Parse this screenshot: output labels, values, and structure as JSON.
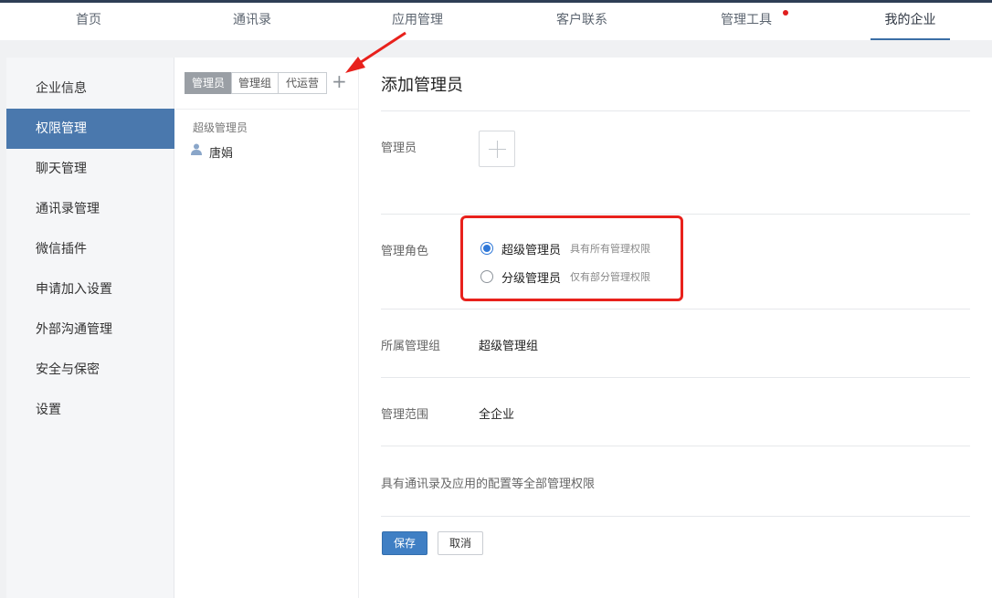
{
  "topnav": {
    "items": [
      "首页",
      "通讯录",
      "应用管理",
      "客户联系",
      "管理工具",
      "我的企业"
    ],
    "active": "我的企业"
  },
  "sidebar": {
    "items": [
      "企业信息",
      "权限管理",
      "聊天管理",
      "通讯录管理",
      "微信插件",
      "申请加入设置",
      "外部沟通管理",
      "安全与保密",
      "设置"
    ],
    "active": "权限管理"
  },
  "middle": {
    "tabs": [
      "管理员",
      "管理组",
      "代运营"
    ],
    "active_tab": "管理员",
    "add_icon": "plus-icon",
    "group_label": "超级管理员",
    "admins": [
      "唐娟"
    ]
  },
  "content": {
    "title": "添加管理员",
    "admin_label": "管理员",
    "role_label": "管理角色",
    "roles": [
      {
        "label": "超级管理员",
        "desc": "具有所有管理权限",
        "checked": true
      },
      {
        "label": "分级管理员",
        "desc": "仅有部分管理权限",
        "checked": false
      }
    ],
    "group_row_label": "所属管理组",
    "group_row_value": "超级管理组",
    "scope_label": "管理范围",
    "scope_value": "全企业",
    "description": "具有通讯录及应用的配置等全部管理权限",
    "save_label": "保存",
    "cancel_label": "取消"
  },
  "colors": {
    "accent": "#4a78ad",
    "radio": "#2f78d8",
    "annotation": "#e8211c",
    "save_button": "#3f7fc4"
  }
}
